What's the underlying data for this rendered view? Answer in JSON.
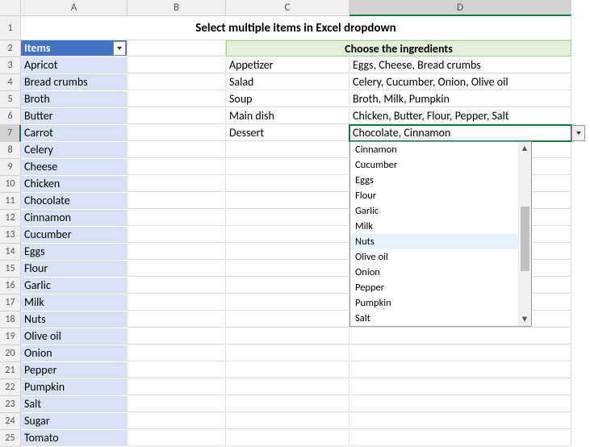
{
  "columns": [
    "A",
    "B",
    "C",
    "D"
  ],
  "title": "Select multiple items in Excel dropdown",
  "headers": {
    "items": "Items",
    "choose": "Choose the ingredients"
  },
  "items": [
    "Apricot",
    "Bread crumbs",
    "Broth",
    "Butter",
    "Carrot",
    "Celery",
    "Cheese",
    "Chicken",
    "Chocolate",
    "Cinnamon",
    "Cucumber",
    "Eggs",
    "Flour",
    "Garlic",
    "Milk",
    "Nuts",
    "Olive oil",
    "Onion",
    "Pepper",
    "Pumpkin",
    "Salt",
    "Sugar",
    "Tomato"
  ],
  "courses": [
    {
      "name": "Appetizer",
      "ing": "Eggs, Cheese, Bread crumbs"
    },
    {
      "name": "Salad",
      "ing": "Celery, Cucumber, Onion, Olive oil"
    },
    {
      "name": "Soup",
      "ing": "Broth, Milk, Pumpkin"
    },
    {
      "name": "Main dish",
      "ing": "Chicken, Butter, Flour, Pepper, Salt"
    },
    {
      "name": "Dessert",
      "ing": "Chocolate, Cinnamon"
    }
  ],
  "dropdown": {
    "options": [
      "Cinnamon",
      "Cucumber",
      "Eggs",
      "Flour",
      "Garlic",
      "Milk",
      "Nuts",
      "Olive oil",
      "Onion",
      "Pepper",
      "Pumpkin",
      "Salt"
    ],
    "hover_index": 6
  },
  "selected_row": 7,
  "selected_col": "D"
}
